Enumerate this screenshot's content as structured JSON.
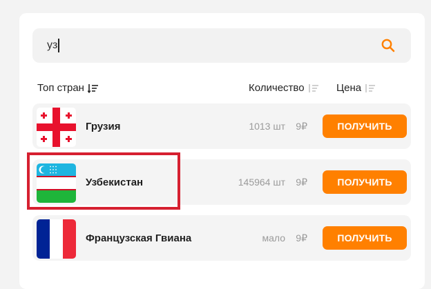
{
  "search": {
    "value": "уз"
  },
  "columns": {
    "country": "Топ стран",
    "quantity": "Количество",
    "price": "Цена"
  },
  "rows": [
    {
      "country": "Грузия",
      "quantity": "1013 шт",
      "price": "9₽",
      "button": "ПОЛУЧИТЬ",
      "flag": "georgia-flag"
    },
    {
      "country": "Узбекистан",
      "quantity": "145964 шт",
      "price": "9₽",
      "button": "ПОЛУЧИТЬ",
      "flag": "uzbekistan-flag"
    },
    {
      "country": "Французская Гвиана",
      "quantity": "мало",
      "price": "9₽",
      "button": "ПОЛУЧИТЬ",
      "flag": "french-guiana-flag"
    }
  ],
  "colors": {
    "accent": "#ff8000",
    "highlight": "#d62030"
  }
}
